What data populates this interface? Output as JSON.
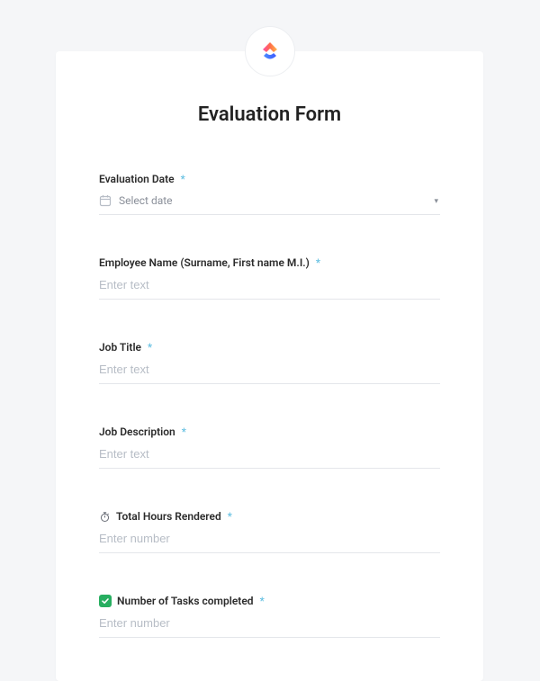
{
  "title": "Evaluation Form",
  "fields": {
    "date": {
      "label": "Evaluation Date",
      "placeholder": "Select date"
    },
    "name": {
      "label": "Employee Name (Surname, First name M.I.)",
      "placeholder": "Enter text"
    },
    "jobTitle": {
      "label": "Job Title",
      "placeholder": "Enter text"
    },
    "jobDesc": {
      "label": "Job Description",
      "placeholder": "Enter text"
    },
    "hours": {
      "label": "Total Hours Rendered",
      "placeholder": "Enter number"
    },
    "tasks": {
      "label": "Number of Tasks completed",
      "placeholder": "Enter number"
    }
  },
  "requiredMark": "*"
}
